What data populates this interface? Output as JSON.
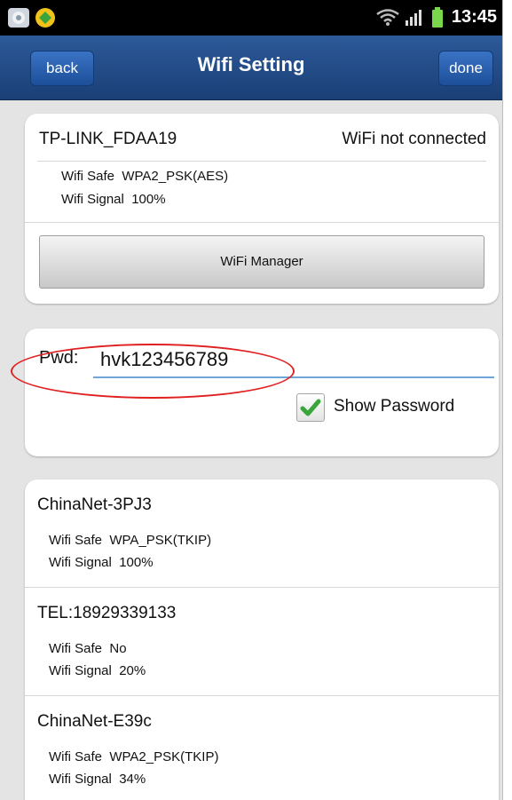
{
  "status_bar": {
    "time": "13:45"
  },
  "header": {
    "title": "Wifi Setting",
    "back_label": "back",
    "done_label": "done"
  },
  "current": {
    "ssid": "TP-LINK_FDAA19",
    "status": "WiFi not connected",
    "safe_label": "Wifi Safe",
    "safe_value": "WPA2_PSK(AES)",
    "signal_label": "Wifi Signal",
    "signal_value": "100%",
    "manager_label": "WiFi Manager"
  },
  "password": {
    "label": "Pwd:",
    "value": "hvk123456789",
    "show_label": "Show Password",
    "show_checked": true
  },
  "networks": [
    {
      "ssid": "ChinaNet-3PJ3",
      "safe_label": "Wifi Safe",
      "safe_value": "WPA_PSK(TKIP)",
      "signal_label": "Wifi Signal",
      "signal_value": "100%"
    },
    {
      "ssid": "TEL:18929339133",
      "safe_label": "Wifi Safe",
      "safe_value": "No",
      "signal_label": "Wifi Signal",
      "signal_value": "20%"
    },
    {
      "ssid": "ChinaNet-E39c",
      "safe_label": "Wifi Safe",
      "safe_value": "WPA2_PSK(TKIP)",
      "signal_label": "Wifi Signal",
      "signal_value": "34%"
    }
  ],
  "colors": {
    "header": "#1f4a86",
    "accent_input": "#6fa6d9",
    "check_green": "#3aa53a",
    "annotation": "#e02020"
  }
}
